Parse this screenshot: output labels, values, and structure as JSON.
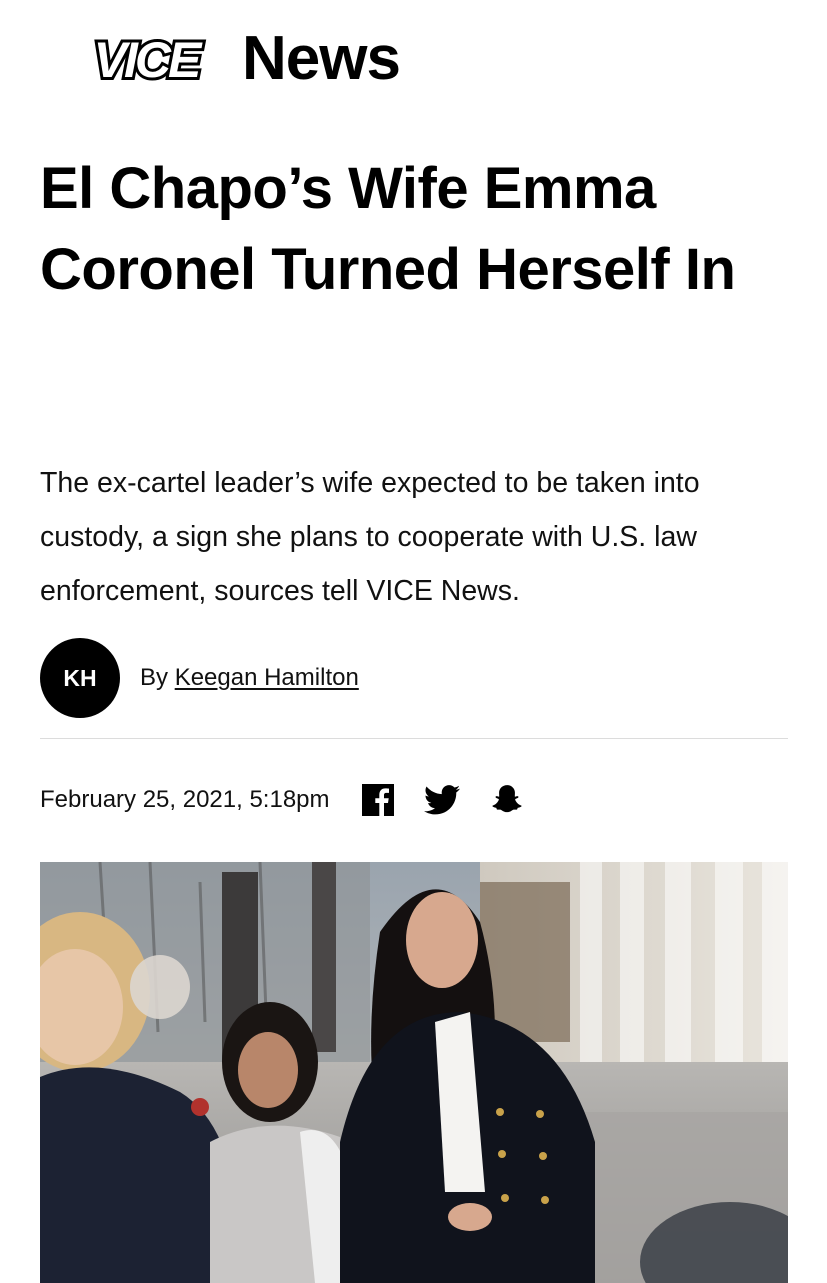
{
  "brand": {
    "logo_text": "VICE",
    "section_name": "News"
  },
  "article": {
    "headline": "El Chapo’s Wife Emma Coronel Turned Herself In",
    "dek": "The ex-cartel leader’s wife expected to be taken into custody, a sign she plans to cooperate with U.S. law enforcement, sources tell VICE News.",
    "byline": {
      "avatar_initials": "KH",
      "prefix": "By",
      "author": "Keegan Hamilton"
    },
    "date": "February 25, 2021, 5:18pm"
  },
  "share": {
    "icons": [
      "facebook-icon",
      "twitter-icon",
      "snapchat-icon"
    ]
  },
  "photo": {
    "subject": "news-photo"
  },
  "colors": {
    "text": "#000000",
    "divider": "#dcdcdc",
    "avatar_bg": "#000000"
  }
}
